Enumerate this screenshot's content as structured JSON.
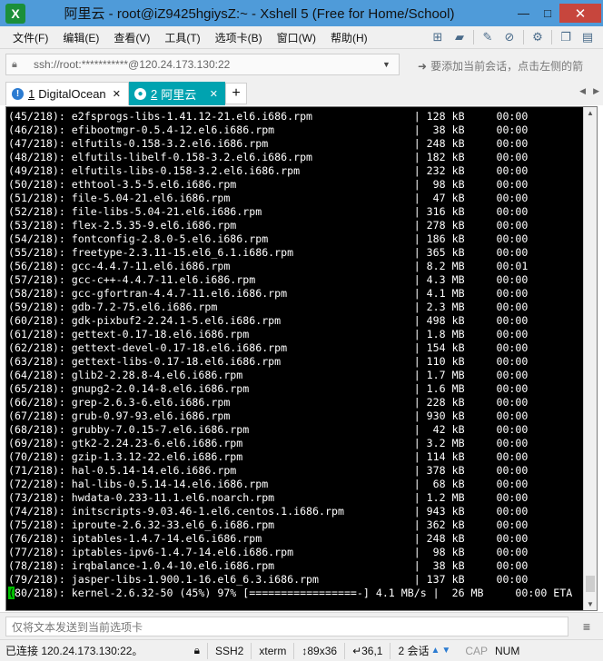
{
  "window": {
    "title": "阿里云 - root@iZ9425hgiysZ:~ - Xshell 5 (Free for Home/School)",
    "min_glyph": "—",
    "max_glyph": "□",
    "close_glyph": "✕"
  },
  "menu": [
    "文件(F)",
    "编辑(E)",
    "查看(V)",
    "工具(T)",
    "选项卡(B)",
    "窗口(W)",
    "帮助(H)"
  ],
  "toolbar_icons": [
    "new-session-icon",
    "open-folder-icon",
    "reconnect-icon",
    "disconnect-icon",
    "properties-icon",
    "copy-icon",
    "paste-icon"
  ],
  "address": {
    "value": "ssh://root:***********@120.24.173.130:22",
    "hint": "要添加当前会话，点击左侧的箭"
  },
  "tabs": [
    {
      "num": "1",
      "label": "DigitalOcean",
      "status": "warning",
      "active": false
    },
    {
      "num": "2",
      "label": "阿里云",
      "status": "connected",
      "active": true
    }
  ],
  "terminal": {
    "lines": [
      "(45/218): e2fsprogs-libs-1.41.12-21.el6.i686.rpm                | 128 kB     00:00",
      "(46/218): efibootmgr-0.5.4-12.el6.i686.rpm                      |  38 kB     00:00",
      "(47/218): elfutils-0.158-3.2.el6.i686.rpm                       | 248 kB     00:00",
      "(48/218): elfutils-libelf-0.158-3.2.el6.i686.rpm                | 182 kB     00:00",
      "(49/218): elfutils-libs-0.158-3.2.el6.i686.rpm                  | 232 kB     00:00",
      "(50/218): ethtool-3.5-5.el6.i686.rpm                            |  98 kB     00:00",
      "(51/218): file-5.04-21.el6.i686.rpm                             |  47 kB     00:00",
      "(52/218): file-libs-5.04-21.el6.i686.rpm                        | 316 kB     00:00",
      "(53/218): flex-2.5.35-9.el6.i686.rpm                            | 278 kB     00:00",
      "(54/218): fontconfig-2.8.0-5.el6.i686.rpm                       | 186 kB     00:00",
      "(55/218): freetype-2.3.11-15.el6_6.1.i686.rpm                   | 365 kB     00:00",
      "(56/218): gcc-4.4.7-11.el6.i686.rpm                             | 8.2 MB     00:01",
      "(57/218): gcc-c++-4.4.7-11.el6.i686.rpm                         | 4.3 MB     00:00",
      "(58/218): gcc-gfortran-4.4.7-11.el6.i686.rpm                    | 4.1 MB     00:00",
      "(59/218): gdb-7.2-75.el6.i686.rpm                               | 2.3 MB     00:00",
      "(60/218): gdk-pixbuf2-2.24.1-5.el6.i686.rpm                     | 498 kB     00:00",
      "(61/218): gettext-0.17-18.el6.i686.rpm                          | 1.8 MB     00:00",
      "(62/218): gettext-devel-0.17-18.el6.i686.rpm                    | 154 kB     00:00",
      "(63/218): gettext-libs-0.17-18.el6.i686.rpm                     | 110 kB     00:00",
      "(64/218): glib2-2.28.8-4.el6.i686.rpm                           | 1.7 MB     00:00",
      "(65/218): gnupg2-2.0.14-8.el6.i686.rpm                          | 1.6 MB     00:00",
      "(66/218): grep-2.6.3-6.el6.i686.rpm                             | 228 kB     00:00",
      "(67/218): grub-0.97-93.el6.i686.rpm                             | 930 kB     00:00",
      "(68/218): grubby-7.0.15-7.el6.i686.rpm                          |  42 kB     00:00",
      "(69/218): gtk2-2.24.23-6.el6.i686.rpm                           | 3.2 MB     00:00",
      "(70/218): gzip-1.3.12-22.el6.i686.rpm                           | 114 kB     00:00",
      "(71/218): hal-0.5.14-14.el6.i686.rpm                            | 378 kB     00:00",
      "(72/218): hal-libs-0.5.14-14.el6.i686.rpm                       |  68 kB     00:00",
      "(73/218): hwdata-0.233-11.1.el6.noarch.rpm                      | 1.2 MB     00:00",
      "(74/218): initscripts-9.03.46-1.el6.centos.1.i686.rpm           | 943 kB     00:00",
      "(75/218): iproute-2.6.32-33.el6_6.i686.rpm                      | 362 kB     00:00",
      "(76/218): iptables-1.4.7-14.el6.i686.rpm                        | 248 kB     00:00",
      "(77/218): iptables-ipv6-1.4.7-14.el6.i686.rpm                   |  98 kB     00:00",
      "(78/218): irqbalance-1.0.4-10.el6.i686.rpm                      |  38 kB     00:00",
      "(79/218): jasper-libs-1.900.1-16.el6_6.3.i686.rpm               | 137 kB     00:00"
    ],
    "current_line": {
      "cursor_char": "(",
      "rest": "80/218): kernel-2.6.32-50 (45%) 97% [=================-] 4.1 MB/s |  26 MB     00:00 ETA"
    }
  },
  "send_bar": {
    "placeholder": "仅将文本发送到当前选项卡"
  },
  "status": {
    "connection": "已连接 120.24.173.130:22。",
    "protocol": "SSH2",
    "term": "xterm",
    "size": "89x36",
    "cursor": "36,1",
    "sessions": "2 会话",
    "cap": "CAP",
    "num": "NUM"
  }
}
